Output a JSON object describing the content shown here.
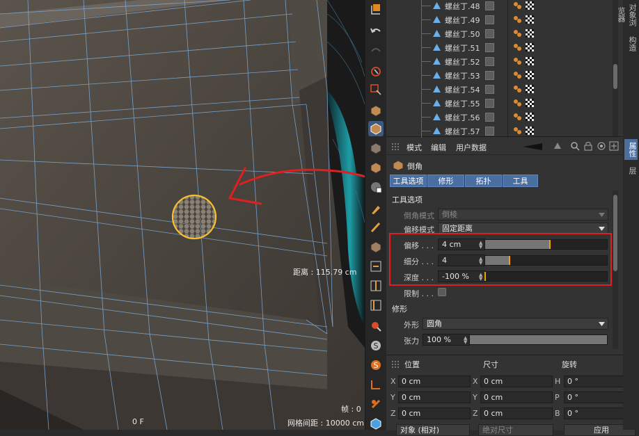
{
  "viewport": {
    "distance_label": "距离 : 115.79 cm",
    "frame_label": "帧 : 0",
    "frame_counter": "0 F",
    "grid_label": "网格间距 : 10000 cm"
  },
  "object_list": {
    "items": [
      {
        "label": "螺丝丁.48"
      },
      {
        "label": "螺丝丁.49"
      },
      {
        "label": "螺丝丁.50"
      },
      {
        "label": "螺丝丁.51"
      },
      {
        "label": "螺丝丁.52"
      },
      {
        "label": "螺丝丁.53"
      },
      {
        "label": "螺丝丁.54"
      },
      {
        "label": "螺丝丁.55"
      },
      {
        "label": "螺丝丁.56"
      },
      {
        "label": "螺丝丁.57"
      }
    ]
  },
  "attributes": {
    "menu": [
      "模式",
      "编辑",
      "用户数据"
    ],
    "object_name": "倒角",
    "tabs": [
      "工具选项",
      "修形",
      "拓扑",
      "工具"
    ],
    "tool_options": {
      "section_title": "工具选项",
      "bevel_mode_label": "倒角模式",
      "bevel_mode_value": "倒棱",
      "offset_mode_label": "偏移模式",
      "offset_mode_value": "固定距离",
      "offset_label": "偏移 . . .",
      "offset_value": "4 cm",
      "offset_fraction": 0.53,
      "subdivision_label": "细分 . . .",
      "subdivision_value": "4",
      "subdivision_fraction": 0.2,
      "depth_label": "深度 . . .",
      "depth_value": "-100 %",
      "depth_fraction": 0.0,
      "limit_label": "限制 . . ."
    },
    "shaping": {
      "section_title": "修形",
      "shape_label": "外形",
      "shape_value": "圆角",
      "tension_label": "张力",
      "tension_value": "100 %",
      "tension_fraction": 1.0
    }
  },
  "coordinates": {
    "headers": [
      "位置",
      "尺寸",
      "旋转"
    ],
    "rows": [
      {
        "pos_axis": "X",
        "pos": "0 cm",
        "size_axis": "X",
        "size": "0 cm",
        "rot_axis": "H",
        "rot": "0 °"
      },
      {
        "pos_axis": "Y",
        "pos": "0 cm",
        "size_axis": "Y",
        "size": "0 cm",
        "rot_axis": "P",
        "rot": "0 °"
      },
      {
        "pos_axis": "Z",
        "pos": "0 cm",
        "size_axis": "Z",
        "size": "0 cm",
        "rot_axis": "B",
        "rot": "0 °"
      }
    ],
    "mode_dropdown": "对象 (相对)",
    "size_dropdown": "绝对尺寸",
    "apply_button": "应用"
  },
  "side_tabs": [
    "对象浏览器",
    "构造",
    "属性",
    "层"
  ],
  "colors": {
    "accent_blue": "#4a6ea0",
    "highlight_red": "#e02020",
    "slider_marker": "#f0a000",
    "selection_yellow": "#f4c030"
  }
}
